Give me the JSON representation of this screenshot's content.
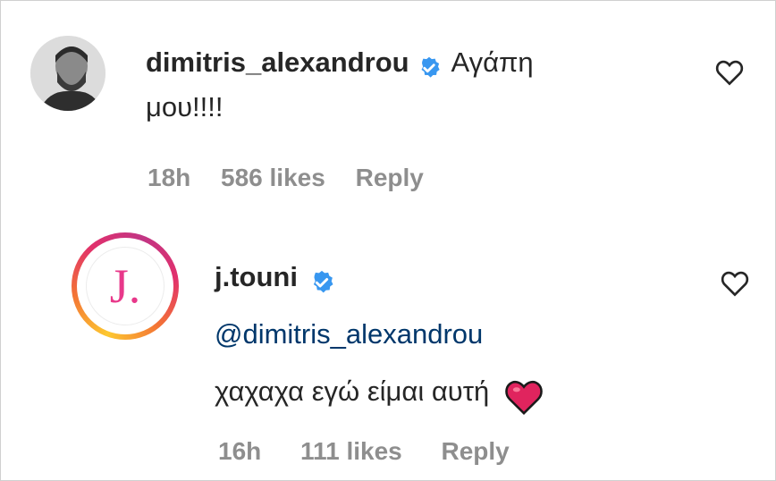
{
  "comments": [
    {
      "username": "dimitris_alexandrou",
      "text_line1": "Αγάπη",
      "text_line2": "μου!!!!",
      "time": "18h",
      "likes": "586 likes",
      "reply": "Reply"
    },
    {
      "username": "j.touni",
      "mention": "@dimitris_alexandrou",
      "text": "χαχαχα εγώ είμαι αυτή",
      "avatar_letter": "J.",
      "time": "16h",
      "likes": "111 likes",
      "reply": "Reply"
    }
  ],
  "colors": {
    "verified": "#3897f0",
    "heart_emoji": "#e0245e",
    "meta": "#8e8e8e",
    "mention": "#00376b",
    "avatar_logo": "#e8388a"
  },
  "icons": {
    "verified": "verified-badge-icon",
    "like": "heart-outline-icon",
    "emoji": "red-heart-emoji"
  }
}
